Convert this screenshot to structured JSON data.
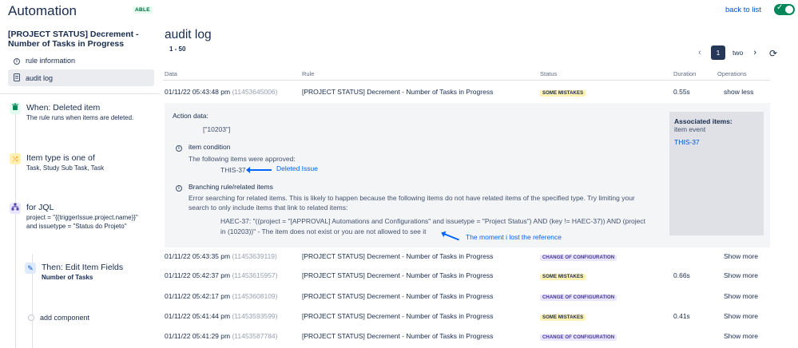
{
  "header": {
    "app_title": "Automation",
    "badge": "ABLE",
    "back_link": "back to list",
    "toggle_state": "on"
  },
  "sidebar": {
    "rule_name": "[PROJECT STATUS] Decrement - Number of Tasks in Progress",
    "links": [
      {
        "label": "rule information",
        "icon": "info-icon"
      },
      {
        "label": "audit log",
        "icon": "document-icon",
        "active": true
      }
    ],
    "steps": [
      {
        "title": "When: Deleted item",
        "desc": [
          "The rule runs when items are deleted."
        ],
        "icon": "trash-icon",
        "color": "#00875a"
      },
      {
        "title": "Item type is one of",
        "desc": [
          "Task, Study Sub Task, Task"
        ],
        "icon": "shuffle-icon",
        "color": "#ffab00"
      },
      {
        "title": "for JQL",
        "desc": [
          "project = \"{{triggerIssue.project.name}}\"",
          "and issuetype = \"Status do Projeto\""
        ],
        "icon": "branch-icon",
        "color": "#5243aa"
      },
      {
        "title": "Then: Edit Item Fields",
        "desc": [
          "Number of Tasks"
        ],
        "icon": "pencil-icon",
        "color": "#0052cc"
      }
    ],
    "add_component": "add component"
  },
  "main": {
    "title": "audit log",
    "range": "1 - 50",
    "pagination": {
      "current": "1",
      "next_page": "two"
    },
    "columns": [
      "Data",
      "Rule",
      "Status",
      "Duration",
      "Operations"
    ],
    "rows": [
      {
        "date": "01/11/22 05:43:48 pm",
        "id": "(11453645006)",
        "rule": "[PROJECT STATUS] Decrement - Number of Tasks in Progress",
        "status": "SOME MISTAKES",
        "duration": "0.55s",
        "operation": "show less"
      },
      {
        "date": "01/11/22 05:43:35 pm",
        "id": "(11453639119)",
        "rule": "[PROJECT STATUS] Decrement - Number of Tasks in Progress",
        "status": "CHANGE OF CONFIGURATION",
        "duration": "",
        "operation": "Show more"
      },
      {
        "date": "01/11/22 05:42:37 pm",
        "id": "(11453615957)",
        "rule": "[PROJECT STATUS] Decrement - Number of Tasks in Progress",
        "status": "SOME MISTAKES",
        "duration": "0.66s",
        "operation": "Show more"
      },
      {
        "date": "01/11/22 05:42:17 pm",
        "id": "(11453608109)",
        "rule": "[PROJECT STATUS] Decrement - Number of Tasks in Progress",
        "status": "CHANGE OF CONFIGURATION",
        "duration": "",
        "operation": "Show more"
      },
      {
        "date": "01/11/22 05:41:44 pm",
        "id": "(11453593599)",
        "rule": "[PROJECT STATUS] Decrement - Number of Tasks in Progress",
        "status": "SOME MISTAKES",
        "duration": "0.41s",
        "operation": "Show more"
      },
      {
        "date": "01/11/22 05:41:29 pm",
        "id": "(11453587784)",
        "rule": "[PROJECT STATUS] Decrement - Number of Tasks in Progress",
        "status": "CHANGE OF CONFIGURATION",
        "duration": "",
        "operation": "Show more"
      }
    ],
    "details": {
      "action_label": "Action data:",
      "action_value": "[\"10203\"]",
      "condition_title": "item condition",
      "condition_text": "The following items were approved:",
      "condition_item": "THIS-37",
      "annotation_deleted": "Deleted Issue",
      "branch_title": "Branching rule/related items",
      "branch_error": [
        "Error searching for related items. This is likely to happen because the following items do not have related items of the specified type. Try limiting your",
        "search to only include items that link to related items:"
      ],
      "branch_query": [
        "HAEC-37: \"((project = \"[APPROVAL] Automations and Configurations\" and issuetype = \"Project Status\") AND (key != HAEC-37)) AND (project",
        "in (10203))\" - The item does not exist or you are not allowed to see it"
      ],
      "annotation_lost": "The moment i lost the reference",
      "assoc_title": "Associated items:",
      "assoc_sub": "item event",
      "assoc_link": "THIS-37"
    }
  }
}
